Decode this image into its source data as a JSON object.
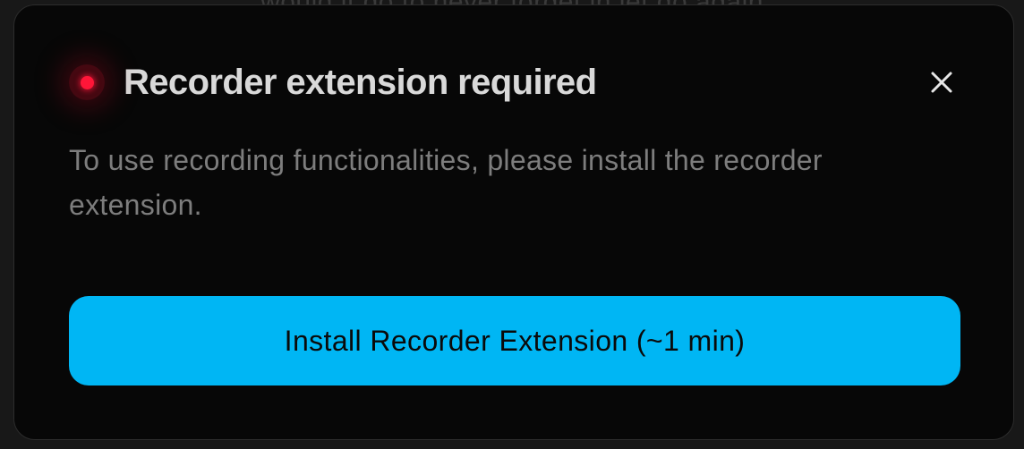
{
  "backdrop": {
    "partial_text": "would it do to never forget in let do again"
  },
  "dialog": {
    "title": "Recorder extension required",
    "description": "To use recording functionalities, please install the recorder extension.",
    "install_button_label": "Install Recorder Extension (~1 min)",
    "close_icon": "close-icon",
    "status_icon": "record-dot-icon"
  },
  "colors": {
    "accent": "#00b6f4",
    "record_red": "#ff1638",
    "dialog_bg": "#070707",
    "title_text": "#d9d9d9",
    "body_text": "#7d7d7d"
  }
}
